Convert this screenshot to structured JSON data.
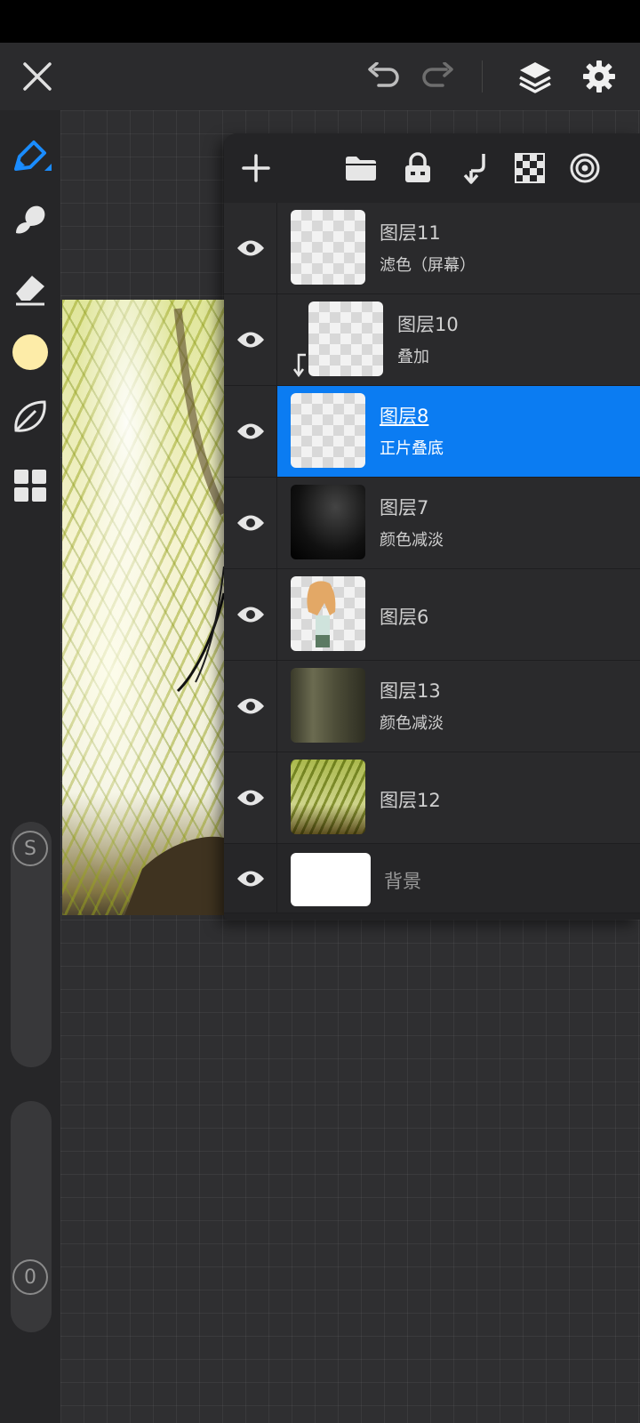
{
  "colors": {
    "accent": "#0b7cf2",
    "brush_color": "#fdeca8",
    "panel_bg": "#222224",
    "canvas_bg": "#2f2f31"
  },
  "topbar": {
    "icons": [
      "close-icon",
      "undo-icon",
      "redo-icon",
      "layers-icon",
      "settings-icon"
    ]
  },
  "left_toolbar": {
    "tools": [
      "pen-icon",
      "smudge-icon",
      "eraser-icon",
      "color-swatch",
      "leaf-brush-icon",
      "grid-icon"
    ],
    "size_slider_label": "S",
    "opacity_slider_label": "0"
  },
  "layer_panel": {
    "toolbar_icons": [
      "add-icon",
      "folder-icon",
      "lock-icon",
      "merge-down-icon",
      "checkerboard-icon",
      "target-icon"
    ],
    "layers": [
      {
        "name": "图层11",
        "mode": "滤色（屏幕）",
        "clipped": false,
        "selected": false
      },
      {
        "name": "图层10",
        "mode": "叠加",
        "clipped": true,
        "selected": false
      },
      {
        "name": "图层8",
        "mode": "正片叠底",
        "clipped": false,
        "selected": true
      },
      {
        "name": "图层7",
        "mode": "颜色减淡",
        "clipped": false,
        "selected": false
      },
      {
        "name": "图层6",
        "mode": "",
        "clipped": false,
        "selected": false
      },
      {
        "name": "图层13",
        "mode": "颜色减淡",
        "clipped": false,
        "selected": false
      },
      {
        "name": "图层12",
        "mode": "",
        "clipped": false,
        "selected": false
      }
    ],
    "background_layer": {
      "name": "背景"
    }
  }
}
